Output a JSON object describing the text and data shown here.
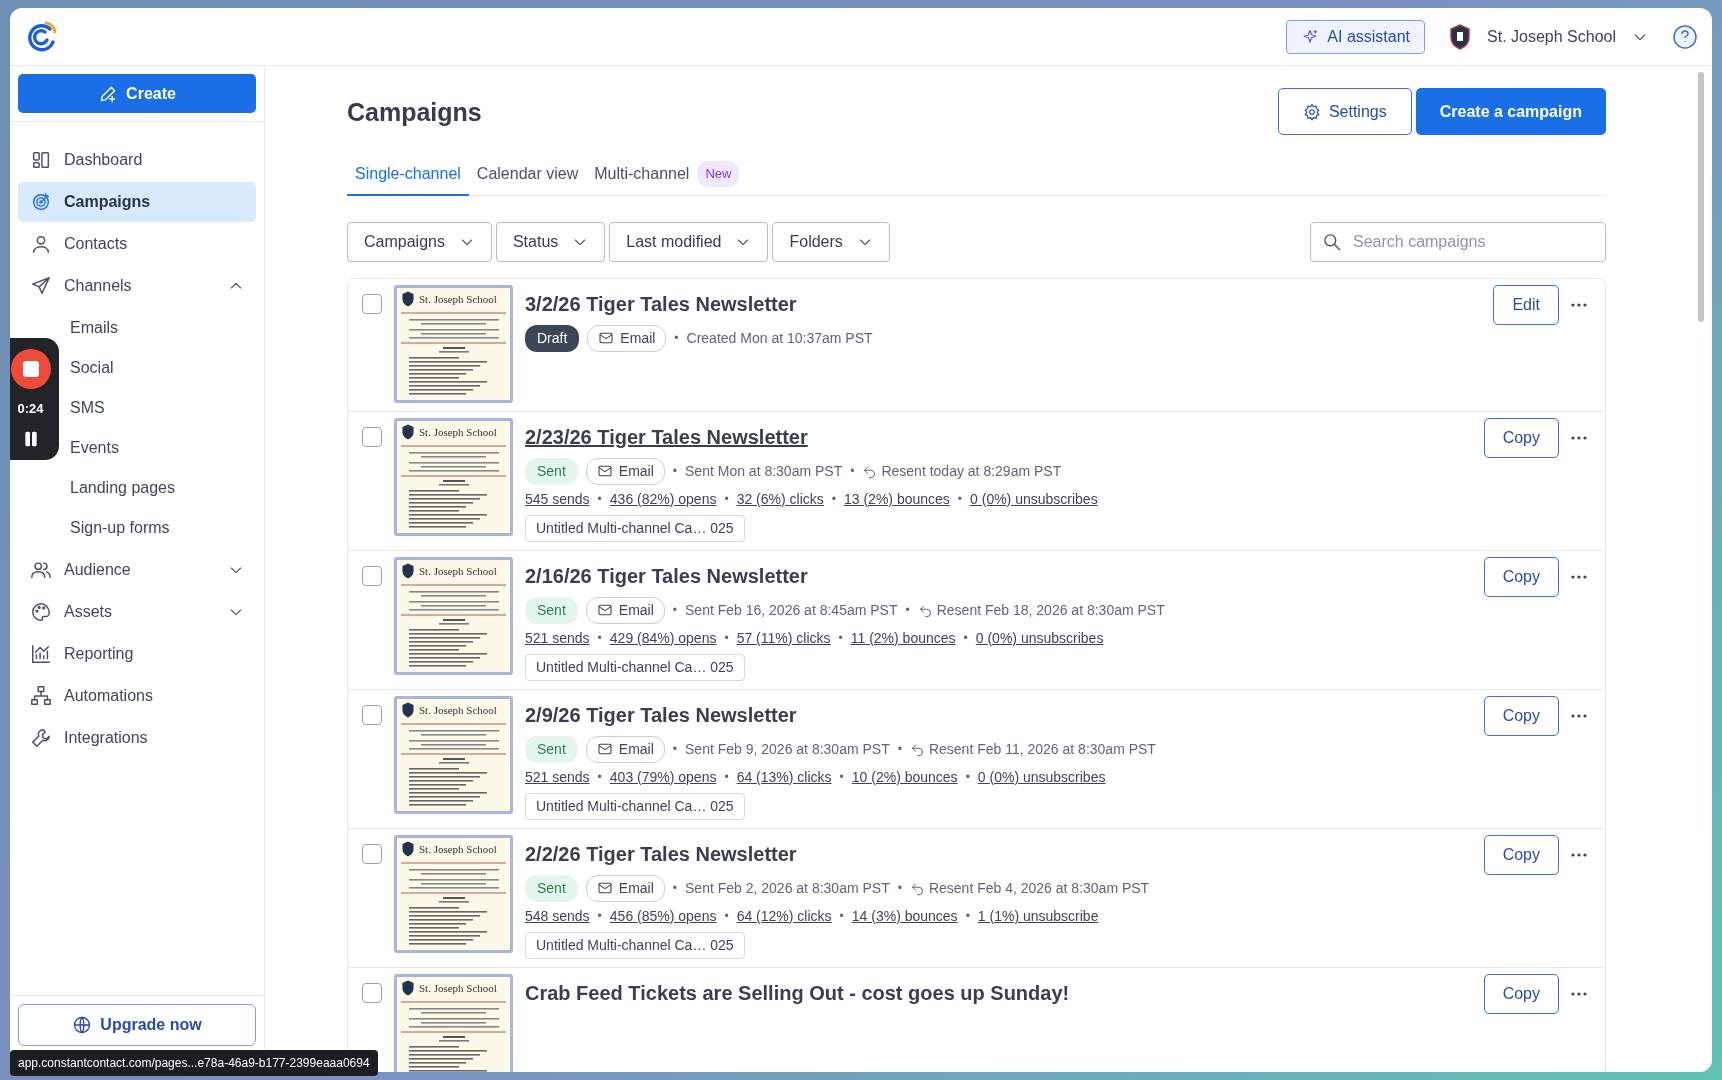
{
  "topbar": {
    "ai_button": "AI assistant",
    "account": "St. Joseph School"
  },
  "sidebar": {
    "create": "Create",
    "items": [
      {
        "label": "Dashboard",
        "kind": "item",
        "selected": false
      },
      {
        "label": "Campaigns",
        "kind": "item",
        "selected": true
      },
      {
        "label": "Contacts",
        "kind": "item",
        "selected": false
      },
      {
        "label": "Channels",
        "kind": "group",
        "selected": false,
        "expanded": true,
        "children": [
          {
            "label": "Emails"
          },
          {
            "label": "Social"
          },
          {
            "label": "SMS"
          },
          {
            "label": "Events"
          },
          {
            "label": "Landing pages"
          },
          {
            "label": "Sign-up forms"
          }
        ]
      },
      {
        "label": "Audience",
        "kind": "group",
        "selected": false,
        "expanded": false
      },
      {
        "label": "Assets",
        "kind": "group",
        "selected": false,
        "expanded": false
      },
      {
        "label": "Reporting",
        "kind": "item",
        "selected": false
      },
      {
        "label": "Automations",
        "kind": "item",
        "selected": false
      },
      {
        "label": "Integrations",
        "kind": "item",
        "selected": false
      }
    ],
    "upgrade": "Upgrade now"
  },
  "page": {
    "title": "Campaigns",
    "settings_button": "Settings",
    "create_button": "Create a campaign",
    "tabs": [
      {
        "label": "Single-channel",
        "selected": true
      },
      {
        "label": "Calendar view",
        "selected": false
      },
      {
        "label": "Multi-channel",
        "selected": false,
        "badge": "New"
      }
    ],
    "filters": [
      "Campaigns",
      "Status",
      "Last modified",
      "Folders"
    ],
    "search": {
      "placeholder": "Search campaigns"
    },
    "campaigns": [
      {
        "title": "3/2/26 Tiger Tales Newsletter",
        "checked": false,
        "hovered": false,
        "thumbnail_header": "St. Joseph School",
        "status": {
          "label": "Draft",
          "kind": "draft"
        },
        "channel": "Email",
        "sent_info": {
          "lead": "•",
          "text": "Created Mon at 10:37am PST"
        },
        "action": "Edit"
      },
      {
        "title": "2/23/26 Tiger Tales Newsletter",
        "checked": false,
        "hovered": true,
        "thumbnail_header": "St. Joseph School",
        "status": {
          "label": "Sent",
          "kind": "sent"
        },
        "channel": "Email",
        "sent_info": {
          "lead": "•",
          "text": "Sent Mon at 8:30am PST"
        },
        "resent_info": {
          "lead": "•",
          "text": "Resent today at 8:29am PST"
        },
        "stats": [
          {
            "text": "545 sends"
          },
          {
            "lead": "•",
            "text": "436 (82%) opens"
          },
          {
            "lead": "•",
            "text": "32 (6%) clicks"
          },
          {
            "lead": "•",
            "text": "13 (2%) bounces"
          },
          {
            "lead": "•",
            "text": "0 (0%) unsubscribes"
          }
        ],
        "folder": "Untitled Multi-channel Ca… 025",
        "action": "Copy"
      },
      {
        "title": "2/16/26 Tiger Tales Newsletter",
        "checked": false,
        "hovered": false,
        "thumbnail_header": "St. Joseph School",
        "status": {
          "label": "Sent",
          "kind": "sent"
        },
        "channel": "Email",
        "sent_info": {
          "lead": "•",
          "text": "Sent Feb 16, 2026 at 8:45am PST"
        },
        "resent_info": {
          "lead": "•",
          "text": "Resent Feb 18, 2026 at 8:30am PST"
        },
        "stats": [
          {
            "text": "521 sends"
          },
          {
            "lead": "•",
            "text": "429 (84%) opens"
          },
          {
            "lead": "•",
            "text": "57 (11%) clicks"
          },
          {
            "lead": "•",
            "text": "11 (2%) bounces"
          },
          {
            "lead": "•",
            "text": "0 (0%) unsubscribes"
          }
        ],
        "folder": "Untitled Multi-channel Ca… 025",
        "action": "Copy"
      },
      {
        "title": "2/9/26 Tiger Tales Newsletter",
        "checked": false,
        "hovered": false,
        "thumbnail_header": "St. Joseph School",
        "status": {
          "label": "Sent",
          "kind": "sent"
        },
        "channel": "Email",
        "sent_info": {
          "lead": "•",
          "text": "Sent Feb 9, 2026 at 8:30am PST"
        },
        "resent_info": {
          "lead": "•",
          "text": "Resent Feb 11, 2026 at 8:30am PST"
        },
        "stats": [
          {
            "text": "521 sends"
          },
          {
            "lead": "•",
            "text": "403 (79%) opens"
          },
          {
            "lead": "•",
            "text": "64 (13%) clicks"
          },
          {
            "lead": "•",
            "text": "10 (2%) bounces"
          },
          {
            "lead": "•",
            "text": "0 (0%) unsubscribes"
          }
        ],
        "folder": "Untitled Multi-channel Ca… 025",
        "action": "Copy"
      },
      {
        "title": "2/2/26 Tiger Tales Newsletter",
        "checked": false,
        "hovered": false,
        "thumbnail_header": "St. Joseph School",
        "status": {
          "label": "Sent",
          "kind": "sent"
        },
        "channel": "Email",
        "sent_info": {
          "lead": "•",
          "text": "Sent Feb 2, 2026 at 8:30am PST"
        },
        "resent_info": {
          "lead": "•",
          "text": "Resent Feb 4, 2026 at 8:30am PST"
        },
        "stats": [
          {
            "text": "548 sends"
          },
          {
            "lead": "•",
            "text": "456 (85%) opens"
          },
          {
            "lead": "•",
            "text": "64 (12%) clicks"
          },
          {
            "lead": "•",
            "text": "14 (3%) bounces"
          },
          {
            "lead": "•",
            "text": "1 (1%) unsubscribe"
          }
        ],
        "folder": "Untitled Multi-channel Ca… 025",
        "action": "Copy"
      },
      {
        "title": "Crab Feed Tickets are Selling Out - cost goes up Sunday!",
        "checked": false,
        "hovered": false,
        "thumbnail_header": "St. Joseph School",
        "action": "Copy"
      }
    ]
  },
  "recorder": {
    "time": "0:24"
  },
  "status_tooltip": "app.constantcontact.com/pages...e78a-46a9-b177-2399eaaa0694"
}
